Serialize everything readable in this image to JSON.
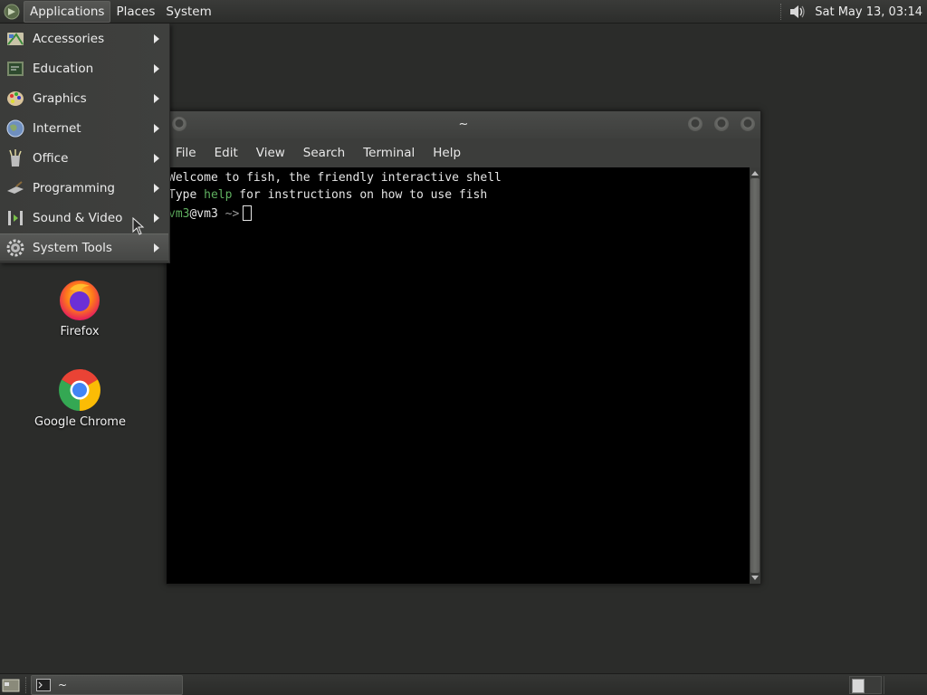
{
  "top_panel": {
    "menus": [
      "Applications",
      "Places",
      "System"
    ],
    "clock": "Sat May 13, 03:14"
  },
  "app_menu": {
    "items": [
      {
        "label": "Accessories",
        "icon": "accessories-icon"
      },
      {
        "label": "Education",
        "icon": "education-icon"
      },
      {
        "label": "Graphics",
        "icon": "graphics-icon"
      },
      {
        "label": "Internet",
        "icon": "internet-icon"
      },
      {
        "label": "Office",
        "icon": "office-icon"
      },
      {
        "label": "Programming",
        "icon": "programming-icon"
      },
      {
        "label": "Sound & Video",
        "icon": "sound-video-icon"
      },
      {
        "label": "System Tools",
        "icon": "system-tools-icon",
        "highlighted": true
      }
    ]
  },
  "desktop": {
    "icons": [
      {
        "label": "Firefox",
        "icon": "firefox-icon"
      },
      {
        "label": "Google Chrome",
        "icon": "chrome-icon"
      }
    ]
  },
  "terminal": {
    "title": "~",
    "menus": [
      "File",
      "Edit",
      "View",
      "Search",
      "Terminal",
      "Help"
    ],
    "lines": {
      "line1": "Welcome to fish, the friendly interactive shell",
      "line2_pre": "Type ",
      "line2_cmd": "help",
      "line2_post": " for instructions on how to use fish",
      "prompt_user": "vm3",
      "prompt_at_host": "@vm3",
      "prompt_arrow": " ~>"
    }
  },
  "bottom_panel": {
    "task_label": "~"
  }
}
